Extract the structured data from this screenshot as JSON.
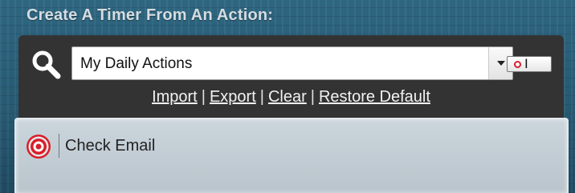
{
  "window": {
    "title": "Create A Timer From An Action:"
  },
  "toolbar": {
    "search_icon": "search-icon",
    "combo": {
      "selected": "My Daily Actions",
      "arrow_icon": "chevron-down-icon"
    },
    "mini_button_icon": "record-cursor-icon",
    "links": [
      {
        "label": "Import"
      },
      {
        "label": "Export"
      },
      {
        "label": "Clear"
      },
      {
        "label": "Restore Default"
      }
    ],
    "separator": "|"
  },
  "actions": {
    "items": [
      {
        "label": "Check Email",
        "icon": "target-icon"
      }
    ]
  },
  "colors": {
    "background": "#275a73",
    "toolbar": "#333333",
    "accent_red": "#d81f2a",
    "panel": "#c3cdd4"
  }
}
